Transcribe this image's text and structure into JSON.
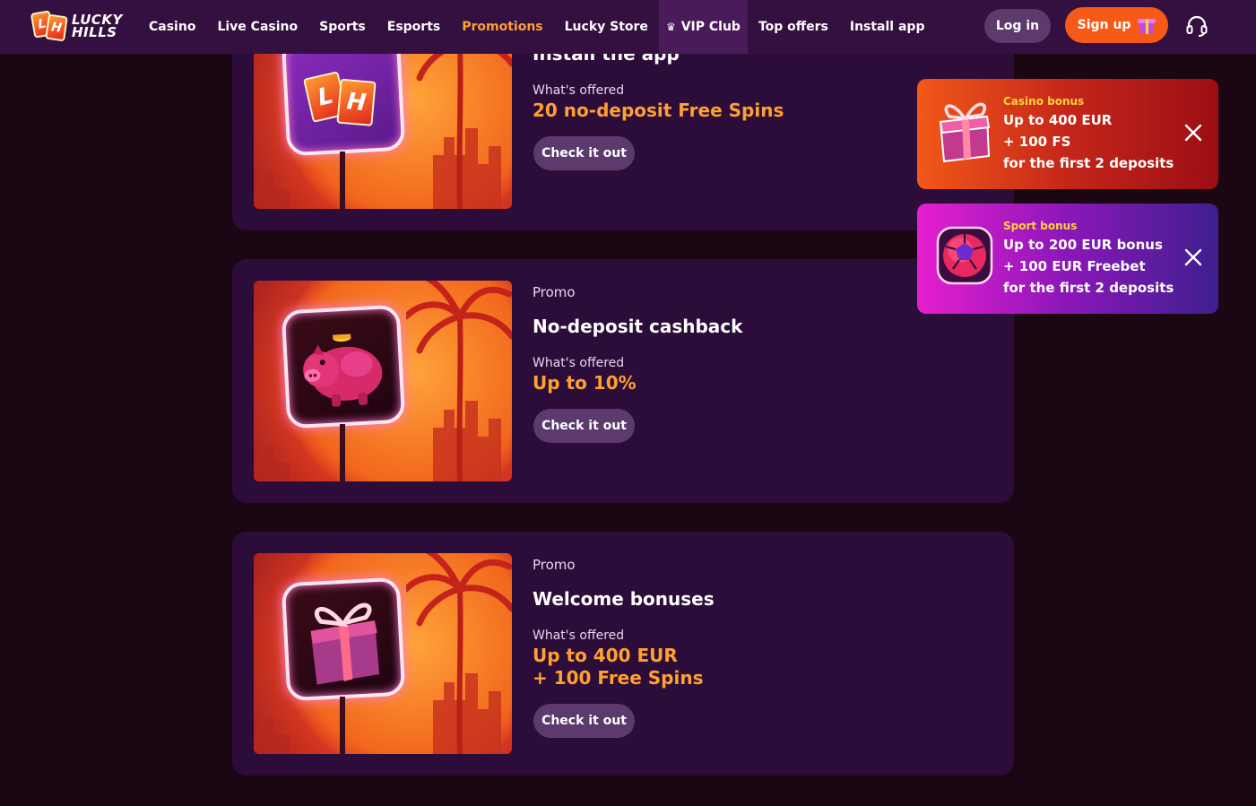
{
  "header": {
    "logo_top": "LUCKY",
    "logo_bottom": "HILLS",
    "nav": [
      {
        "label": "Casino"
      },
      {
        "label": "Live Casino"
      },
      {
        "label": "Sports"
      },
      {
        "label": "Esports"
      },
      {
        "label": "Promotions",
        "active": true
      },
      {
        "label": "Lucky Store"
      },
      {
        "label": "VIP Club"
      },
      {
        "label": "Top offers"
      },
      {
        "label": "Install app"
      }
    ],
    "login_label": "Log in",
    "signup_label": "Sign up",
    "accent_color": "#ffa030",
    "signup_color": "#f75a17"
  },
  "cards": [
    {
      "title": "Install the app",
      "offer_label": "What's offered",
      "offer_value": "20 no-deposit Free Spins",
      "button_label": "Check it out",
      "art_icon": "lh-logo-sign-icon"
    },
    {
      "kicker": "Promo",
      "title": "No-deposit cashback",
      "offer_label": "What's offered",
      "offer_value": "Up to 10%",
      "button_label": "Check it out",
      "art_icon": "piggy-bank-icon"
    },
    {
      "kicker": "Promo",
      "title": "Welcome bonuses",
      "offer_label": "What's offered",
      "offer_value_line1": "Up to 400 EUR",
      "offer_value_line2": "+ 100 Free Spins",
      "button_label": "Check it out",
      "art_icon": "gift-box-icon"
    }
  ],
  "toasts": [
    {
      "kicker": "Casino bonus",
      "line1": "Up to 400 EUR",
      "line2": "+ 100 FS",
      "line3": "for the first 2 deposits",
      "icon": "gift-box-icon"
    },
    {
      "kicker": "Sport bonus",
      "line1": "Up to 200 EUR bonus",
      "line2": "+ 100 EUR Freebet",
      "line3": "for the first 2 deposits",
      "icon": "soccer-ball-icon"
    }
  ]
}
